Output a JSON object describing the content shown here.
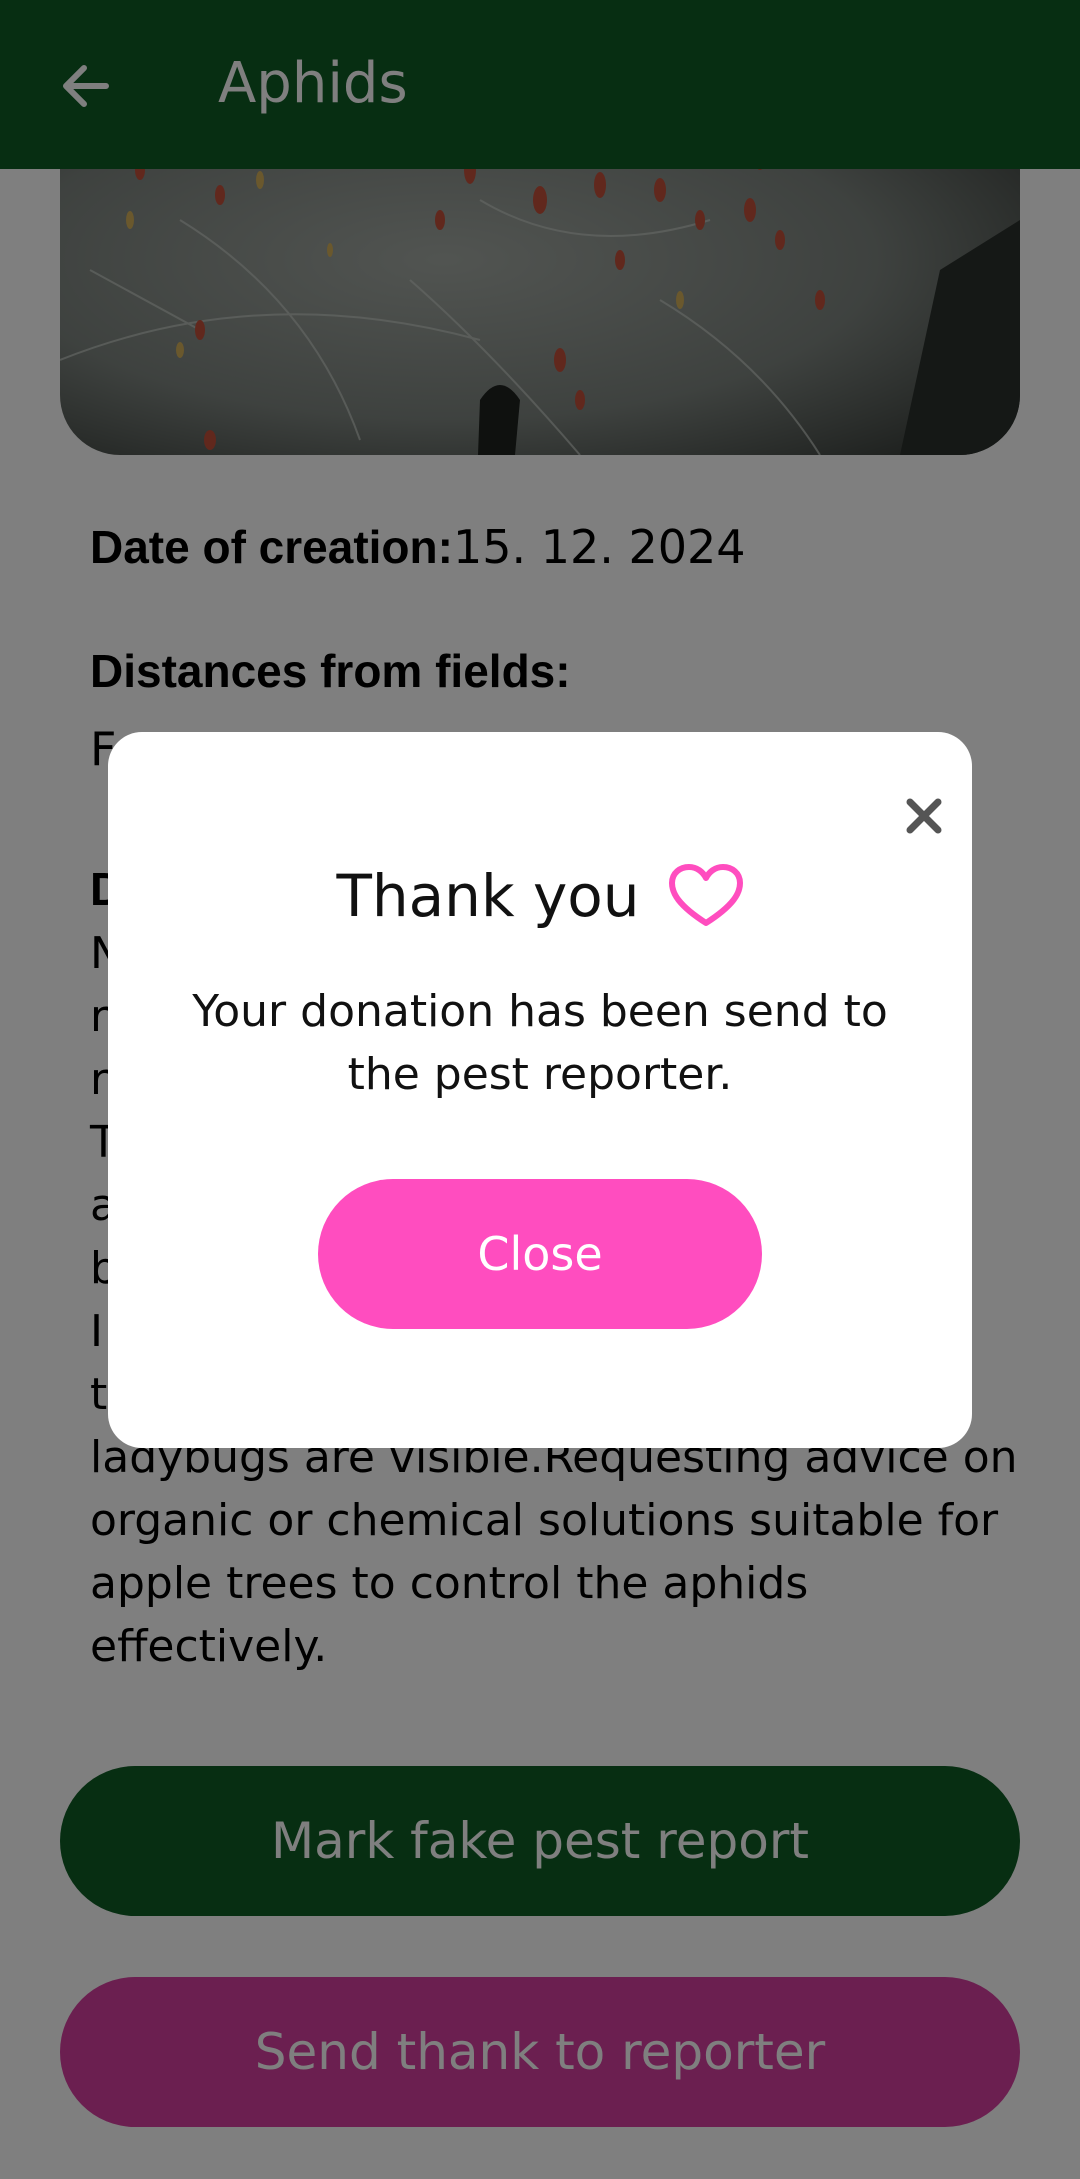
{
  "appbar": {
    "title": "Aphids",
    "back_icon": "arrow-left-icon"
  },
  "report": {
    "date_label": "Date of creation:",
    "date_value": "15. 12. 2024",
    "distances_label": "Distances from fields:",
    "distances_value": "F",
    "description_label": "D",
    "description_text": "N                                                               n\nr\nr\nT\na\nb\nI                                                              er\nt\nladybugs are visible.Requesting advice on organic or chemical solutions suitable for apple trees to control the aphids effectively."
  },
  "buttons": {
    "mark_fake": "Mark fake pest report",
    "send_thank": "Send thank to reporter"
  },
  "dialog": {
    "title": "Thank you",
    "message": "Your donation has been send to the pest reporter.",
    "close_label": "Close",
    "close_icon": "close-icon",
    "heart_icon": "heart-icon"
  },
  "colors": {
    "appbar": "#0e5c25",
    "accent_pink": "#ff4dbf",
    "thank_button": "#d63fa0"
  }
}
